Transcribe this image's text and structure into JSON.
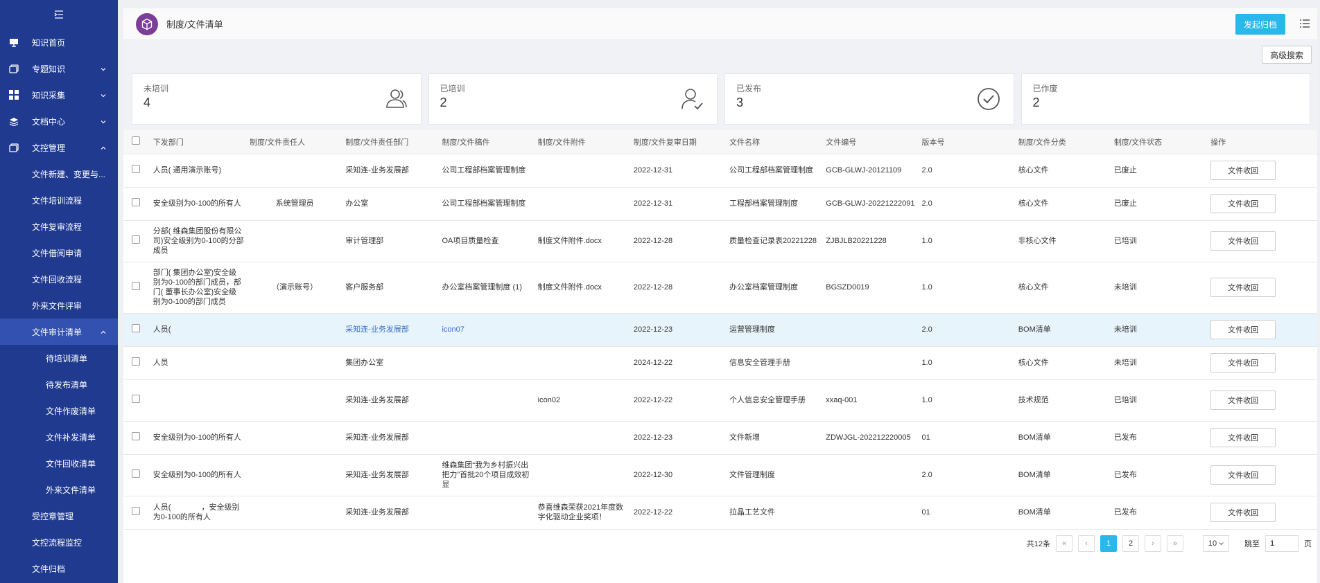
{
  "sidebar": {
    "items": [
      {
        "label": "知识首页",
        "icon": "monitor-icon",
        "level": 0
      },
      {
        "label": "专题知识",
        "icon": "stack-icon",
        "level": 0,
        "chevron": "down"
      },
      {
        "label": "知识采集",
        "icon": "grid-icon",
        "level": 0,
        "chevron": "down"
      },
      {
        "label": "文档中心",
        "icon": "layers-icon",
        "level": 0,
        "chevron": "down"
      },
      {
        "label": "文控管理",
        "icon": "stack-icon",
        "level": 0,
        "chevron": "up"
      },
      {
        "label": "文件新建、变更与...",
        "level": 1
      },
      {
        "label": "文件培训流程",
        "level": 1
      },
      {
        "label": "文件复审流程",
        "level": 1
      },
      {
        "label": "文件借阅申请",
        "level": 1
      },
      {
        "label": "文件回收流程",
        "level": 1
      },
      {
        "label": "外来文件评审",
        "level": 1
      },
      {
        "label": "文件审计清单",
        "level": 1,
        "chevron": "up",
        "active": true
      },
      {
        "label": "待培训清单",
        "level": 2
      },
      {
        "label": "待发布清单",
        "level": 2
      },
      {
        "label": "文件作废清单",
        "level": 2
      },
      {
        "label": "文件补发清单",
        "level": 2
      },
      {
        "label": "文件回收清单",
        "level": 2
      },
      {
        "label": "外来文件清单",
        "level": 2
      },
      {
        "label": "受控章管理",
        "level": 1
      },
      {
        "label": "文控流程监控",
        "level": 1
      },
      {
        "label": "文件归档",
        "level": 1
      }
    ]
  },
  "header": {
    "title": "制度/文件清单",
    "primary_button": "发起归档"
  },
  "toolbar": {
    "advanced_search": "高级搜索"
  },
  "stats": [
    {
      "label": "未培训",
      "value": "4",
      "icon": "users-icon"
    },
    {
      "label": "已培训",
      "value": "2",
      "icon": "user-check-icon"
    },
    {
      "label": "已发布",
      "value": "3",
      "icon": "check-circle-icon"
    },
    {
      "label": "已作废",
      "value": "2",
      "icon": ""
    }
  ],
  "table": {
    "columns": [
      "下发部门",
      "制度/文件责任人",
      "制度/文件责任部门",
      "制度/文件稿件",
      "制度/文件附件",
      "制度/文件复审日期",
      "文件名称",
      "文件编号",
      "版本号",
      "制度/文件分类",
      "制度/文件状态",
      "操作"
    ],
    "action_label": "文件收回",
    "rows": [
      {
        "dept": "人员( 通用演示账号)",
        "owner": "",
        "owner_dept": "采知连-业务发展部",
        "draft": "公司工程部档案管理制度",
        "attach": "",
        "date": "2022-12-31",
        "name": "公司工程部档案管理制度",
        "code": "GCB-GLWJ-20121109",
        "ver": "2.0",
        "cat": "核心文件",
        "status": "已废止"
      },
      {
        "dept": "安全级别为0-100的所有人",
        "owner": "系统管理员",
        "owner_dept": "办公室",
        "draft": "公司工程部档案管理制度",
        "attach": "",
        "date": "2022-12-31",
        "name": "工程部档案管理制度",
        "code": "GCB-GLWJ-20221222091",
        "ver": "2.0",
        "cat": "核心文件",
        "status": "已废止"
      },
      {
        "dept": "分部( 维森集团股份有限公司)安全级别为0-100的分部成员",
        "owner": "",
        "owner_dept": "审计管理部",
        "draft": "OA项目质量检查",
        "attach": "制度文件附件.docx",
        "date": "2022-12-28",
        "name": "质量检查记录表20221228",
        "code": "ZJBJLB20221228",
        "ver": "1.0",
        "cat": "非核心文件",
        "status": "已培训"
      },
      {
        "dept": "部门( 集团办公室)安全级别为0-100的部门成员，部门( 董事长办公室)安全级别为0-100的部门成员",
        "owner": "（演示账号）",
        "owner_dept": "客户服务部",
        "draft": "办公室档案管理制度 (1)",
        "attach": "制度文件附件.docx",
        "date": "2022-12-28",
        "name": "办公室档案管理制度",
        "code": "BGSZD0019",
        "ver": "1.0",
        "cat": "核心文件",
        "status": "未培训"
      },
      {
        "dept": "人员(",
        "owner": "",
        "owner_dept": "采知连-业务发展部",
        "draft": "icon07",
        "attach": "",
        "date": "2022-12-23",
        "name": "运营管理制度",
        "code": "",
        "ver": "2.0",
        "cat": "BOM清单",
        "status": "未培训",
        "highlight": true
      },
      {
        "dept": "人员",
        "owner": "",
        "owner_dept": "集团办公室",
        "draft": "",
        "attach": "",
        "date": "2024-12-22",
        "name": "信息安全管理手册",
        "code": "",
        "ver": "1.0",
        "cat": "核心文件",
        "status": "未培训"
      },
      {
        "dept": "",
        "owner": "",
        "owner_dept": "采知连-业务发展部",
        "draft": "",
        "attach": "icon02",
        "date": "2022-12-22",
        "name": "个人信息安全管理手册",
        "code": "xxaq-001",
        "ver": "1.0",
        "cat": "技术规范",
        "status": "已培训"
      },
      {
        "dept": "安全级别为0-100的所有人",
        "owner": "",
        "owner_dept": "采知连-业务发展部",
        "draft": "",
        "attach": "",
        "date": "2022-12-23",
        "name": "文件新增",
        "code": "ZDWJGL-202212220005",
        "ver": "01",
        "cat": "BOM清单",
        "status": "已发布"
      },
      {
        "dept": "安全级别为0-100的所有人",
        "owner": "",
        "owner_dept": "采知连-业务发展部",
        "draft": "维森集团“我为乡村振兴出把力”首批20个项目成效初显",
        "attach": "",
        "date": "2022-12-30",
        "name": "文件管理制度",
        "code": "",
        "ver": "2.0",
        "cat": "BOM清单",
        "status": "已发布"
      },
      {
        "dept": "人员(　　　　，安全级别为0-100的所有人",
        "owner": "",
        "owner_dept": "采知连-业务发展部",
        "draft": "",
        "attach": "恭喜维森荣获2021年度数字化驱动企业奖项！",
        "date": "2022-12-22",
        "name": "拉晶工艺文件",
        "code": "",
        "ver": "01",
        "cat": "BOM清单",
        "status": "已发布"
      }
    ]
  },
  "pagination": {
    "total": "共12条",
    "pages": [
      "1",
      "2"
    ],
    "current": "1",
    "page_size": "10",
    "goto_label": "跳至",
    "goto_value": "1",
    "page_unit": "页"
  },
  "colors": {
    "sidebar_bg": "#1f3a8f",
    "sidebar_active": "#3251b0",
    "accent": "#2ab7ea",
    "logo": "#7b3f98",
    "link": "#3a6fc4"
  }
}
